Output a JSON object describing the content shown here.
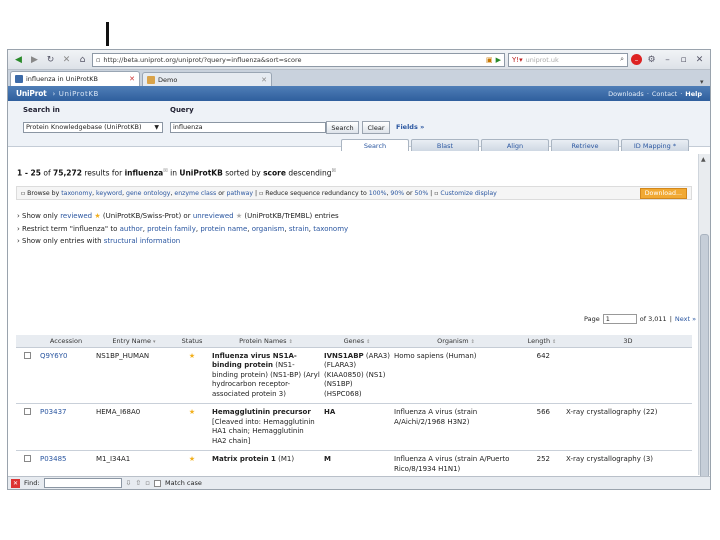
{
  "browser": {
    "url": "http://beta.uniprot.org/uniprot/?query=influenza&sort=score",
    "search_placeholder": "uniprot.uk",
    "tabs": [
      {
        "label": "influenza in UniProtKB"
      },
      {
        "label": "Demo"
      }
    ]
  },
  "banner": {
    "logo": "UniProt",
    "crumb": "› UniProtKB",
    "links": [
      "Downloads",
      "·",
      "Contact",
      "·",
      "Help"
    ]
  },
  "search": {
    "search_in_label": "Search in",
    "query_label": "Query",
    "database": "Protein Knowledgebase (UniProtKB)",
    "query": "influenza",
    "search_btn": "Search",
    "clear_btn": "Clear",
    "fields_link": "Fields »",
    "tools": [
      "Search",
      "Blast",
      "Align",
      "Retrieve",
      "ID Mapping *"
    ]
  },
  "results": {
    "range": "1 - 25",
    "of": "of",
    "total": "75,272",
    "results_for": "results for",
    "term": "influenza",
    "in": "in",
    "db": "UniProtKB",
    "sorted_by": "sorted by",
    "sort": "score",
    "order": "descending"
  },
  "options_bar": {
    "browse": "Browse by",
    "by_links": [
      "taxonomy",
      "keyword",
      "gene ontology",
      "enzyme class",
      "pathway"
    ],
    "reduce": "Reduce sequence redundancy to",
    "pct": [
      "100%",
      "90%",
      "50%"
    ],
    "customize": "Customize display",
    "download": "Download..."
  },
  "filters": {
    "line1": {
      "prefix": "› Show only",
      "reviewed": "reviewed",
      "mid": "(UniProtKB/Swiss-Prot) or",
      "unreviewed": "unreviewed",
      "suffix": "(UniProtKB/TrEMBL) entries"
    },
    "line2": {
      "prefix": "› Restrict term \"influenza\" to",
      "links": [
        "author",
        "protein family",
        "protein name",
        "organism",
        "strain",
        "taxonomy"
      ]
    },
    "line3": {
      "prefix": "› Show only entries with",
      "link": "structural information"
    }
  },
  "pager": {
    "page_label": "Page",
    "page": "1",
    "of": "of 3,011",
    "next": "Next »"
  },
  "table": {
    "headers": [
      "Accession",
      "Entry Name",
      "Status",
      "Protein Names",
      "Genes",
      "Organism",
      "Length",
      "3D"
    ],
    "rows": [
      {
        "accession": "Q9Y6Y0",
        "entry": "NS1BP_HUMAN",
        "protein_bold": "Influenza virus NS1A-binding protein",
        "protein_rest": "(NS1-binding protein) (NS1-BP) (Aryl hydrocarbon receptor-associated protein 3)",
        "gene_bold": "IVNS1ABP",
        "gene_rest": "(ARA3) (FLARA3) (KIAA0850) (NS1) (NS1BP) (HSPC068)",
        "organism": "Homo sapiens (Human)",
        "length": "642",
        "structure": ""
      },
      {
        "accession": "P03437",
        "entry": "HEMA_I68A0",
        "protein_bold": "Hemagglutinin precursor",
        "protein_rest": "[Cleaved into: Hemagglutinin HA1 chain; Hemagglutinin HA2 chain]",
        "gene_bold": "HA",
        "gene_rest": "",
        "organism": "Influenza A virus (strain A/Aichi/2/1968 H3N2)",
        "length": "566",
        "structure": "X-ray crystallography (22)"
      },
      {
        "accession": "P03485",
        "entry": "M1_I34A1",
        "protein_bold": "Matrix protein 1",
        "protein_rest": "(M1)",
        "gene_bold": "M",
        "gene_rest": "",
        "organism": "Influenza A virus (strain A/Puerto Rico/8/1934 H1N1)",
        "length": "252",
        "structure": "X-ray crystallography (3)"
      }
    ]
  },
  "findbar": {
    "label": "Find:",
    "match_case": "Match case"
  }
}
